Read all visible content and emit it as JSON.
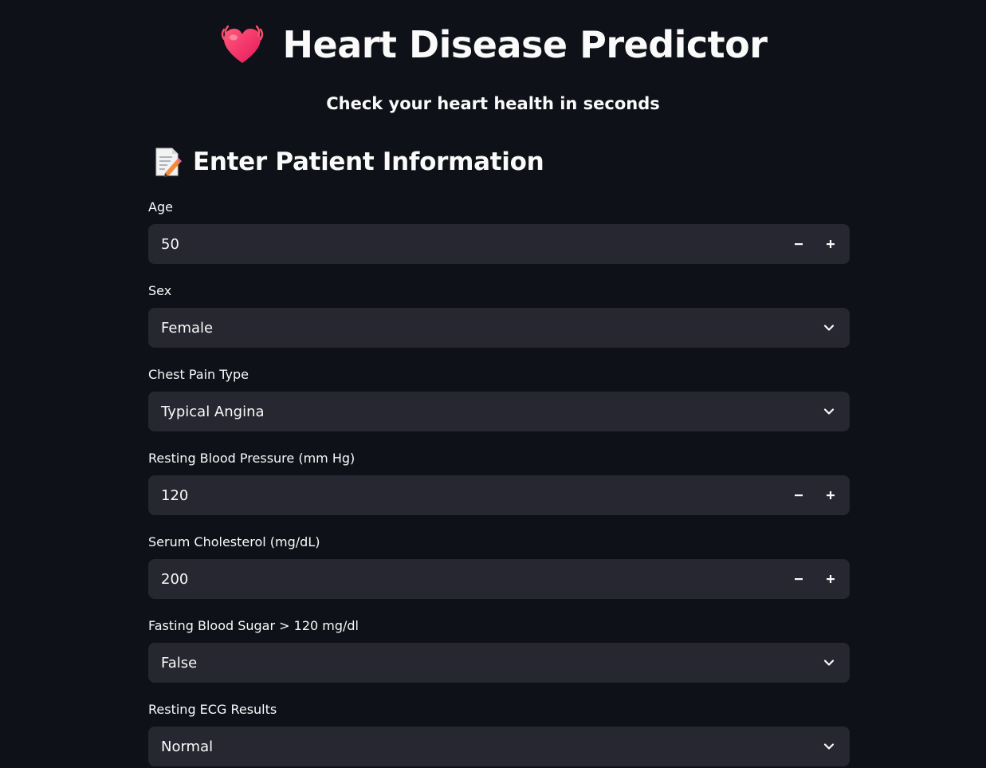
{
  "header": {
    "title_icon": "beating-heart-icon",
    "title": "Heart Disease Predictor",
    "subtitle": "Check your heart health in seconds"
  },
  "section": {
    "icon": "memo-icon",
    "title": "Enter Patient Information"
  },
  "fields": {
    "age": {
      "label": "Age",
      "value": "50",
      "type": "number"
    },
    "sex": {
      "label": "Sex",
      "value": "Female",
      "type": "select"
    },
    "chest_pain": {
      "label": "Chest Pain Type",
      "value": "Typical Angina",
      "type": "select"
    },
    "resting_bp": {
      "label": "Resting Blood Pressure (mm Hg)",
      "value": "120",
      "type": "number"
    },
    "cholesterol": {
      "label": "Serum Cholesterol (mg/dL)",
      "value": "200",
      "type": "number"
    },
    "fasting_bs": {
      "label": "Fasting Blood Sugar > 120 mg/dl",
      "value": "False",
      "type": "select"
    },
    "resting_ecg": {
      "label": "Resting ECG Results",
      "value": "Normal",
      "type": "select"
    }
  },
  "colors": {
    "background": "#0e1117",
    "input_background": "#262730",
    "text": "#fafafa",
    "heart": "#ff3b6b"
  }
}
